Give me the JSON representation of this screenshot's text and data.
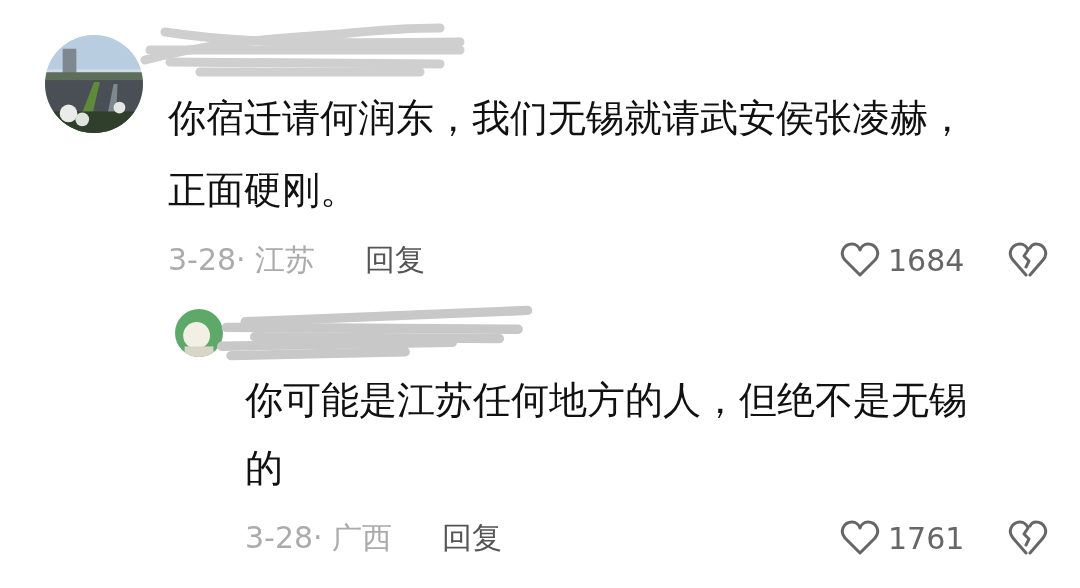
{
  "comments": [
    {
      "text": "你宿迁请何润东，我们无锡就请武安侯张凌赫，正面硬刚。",
      "meta": "3-28· 江苏",
      "reply_label": "回复",
      "likes": "1684",
      "replies": [
        {
          "text": "你可能是江苏任何地方的人，但绝不是无锡的",
          "meta": "3-28· 广西",
          "reply_label": "回复",
          "likes": "1761"
        }
      ]
    }
  ]
}
